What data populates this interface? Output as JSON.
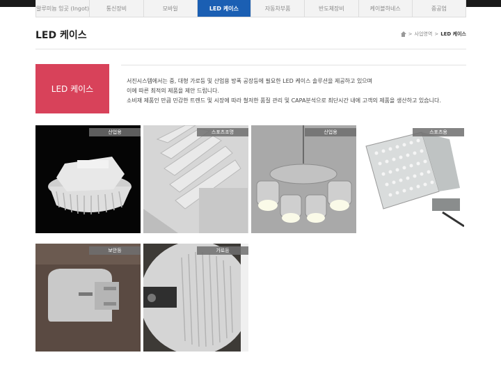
{
  "nav": {
    "items": [
      {
        "label": "알루미늄 잉곳 (Ingot)",
        "active": false
      },
      {
        "label": "통신장비",
        "active": false
      },
      {
        "label": "모바일",
        "active": false
      },
      {
        "label": "LED 케이스",
        "active": true
      },
      {
        "label": "자동차부품",
        "active": false
      },
      {
        "label": "반도체장비",
        "active": false
      },
      {
        "label": "케이블하네스",
        "active": false
      },
      {
        "label": "중공업",
        "active": false
      }
    ]
  },
  "page": {
    "title": "LED 케이스",
    "breadcrumb": {
      "level1": "사업영역",
      "sep": ">",
      "current": "LED 케이스"
    }
  },
  "intro": {
    "badge": "LED 케이스",
    "lines": [
      "서진시스템에서는 중, 대형 가로등 및 산업용 방폭 공장등에 필요한 LED 케이스 솔루션을 제공하고 있으며",
      "이에 따른 최적의 제품을 제안 드립니다.",
      "소비재 제품인 만큼 민감한 트렌드 및 시장에 따라 철저한 품질 관리 및 CAPA분석으로 최단시간 내에 고객의 제품을 생산하고 있습니다."
    ]
  },
  "gallery": [
    {
      "tag": "산업용"
    },
    {
      "tag": "스포츠조명"
    },
    {
      "tag": "산업용"
    },
    {
      "tag": "스포츠용"
    },
    {
      "tag": "보안등"
    },
    {
      "tag": "가로등"
    }
  ],
  "colors": {
    "nav_active": "#1b5fb3",
    "badge": "#d8425a"
  }
}
